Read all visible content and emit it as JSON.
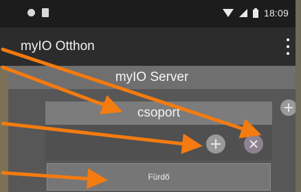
{
  "statusbar": {
    "time": "18:09",
    "icons": [
      "notification-dot-icon",
      "sd-card-icon",
      "wifi-icon",
      "cell-signal-icon",
      "battery-icon"
    ]
  },
  "toolbar": {
    "title": "myIO Otthon",
    "menu_icon": "overflow-menu-icon"
  },
  "server": {
    "label": "myIO Server"
  },
  "group": {
    "header": "csoport",
    "add_icon": "plus-circle-icon",
    "remove_icon": "close-circle-icon"
  },
  "room": {
    "label": "Fürdő"
  },
  "colors": {
    "statusbar": "#1c1c1c",
    "toolbar": "#2c2c2c",
    "server_bar": "#6f6f6f",
    "group_header": "#7c7c7c",
    "arrow": "#f47b10"
  }
}
